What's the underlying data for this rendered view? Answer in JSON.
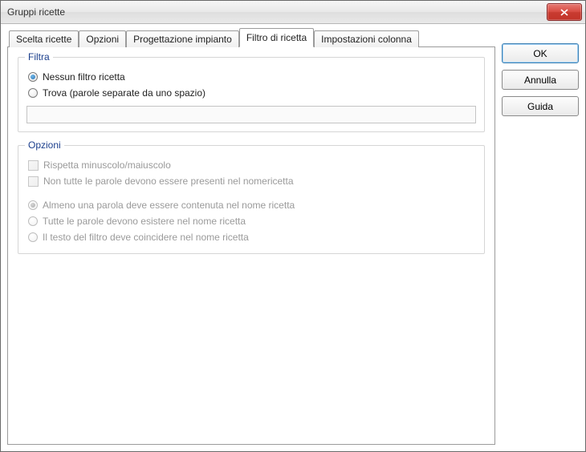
{
  "window": {
    "title": "Gruppi ricette"
  },
  "buttons": {
    "ok": "OK",
    "cancel": "Annulla",
    "help": "Guida"
  },
  "tabs": [
    {
      "label": "Scelta ricette",
      "active": false
    },
    {
      "label": "Opzioni",
      "active": false
    },
    {
      "label": "Progettazione impianto",
      "active": false
    },
    {
      "label": "Filtro di ricetta",
      "active": true
    },
    {
      "label": "Impostazioni colonna",
      "active": false
    }
  ],
  "group_filtra": {
    "legend": "Filtra",
    "radio_none": "Nessun filtro ricetta",
    "radio_find": "Trova (parole separate da uno spazio)",
    "search_value": ""
  },
  "group_opzioni": {
    "legend": "Opzioni",
    "chk_case": "Rispetta minuscolo/maiuscolo",
    "chk_notall": "Non tutte le parole devono essere presenti nel nomericetta",
    "radio_atleastone": "Almeno una parola deve essere contenuta nel nome ricetta",
    "radio_allexist": "Tutte le parole devono esistere nel nome ricetta",
    "radio_exact": "Il testo del filtro deve coincidere nel nome ricetta"
  }
}
